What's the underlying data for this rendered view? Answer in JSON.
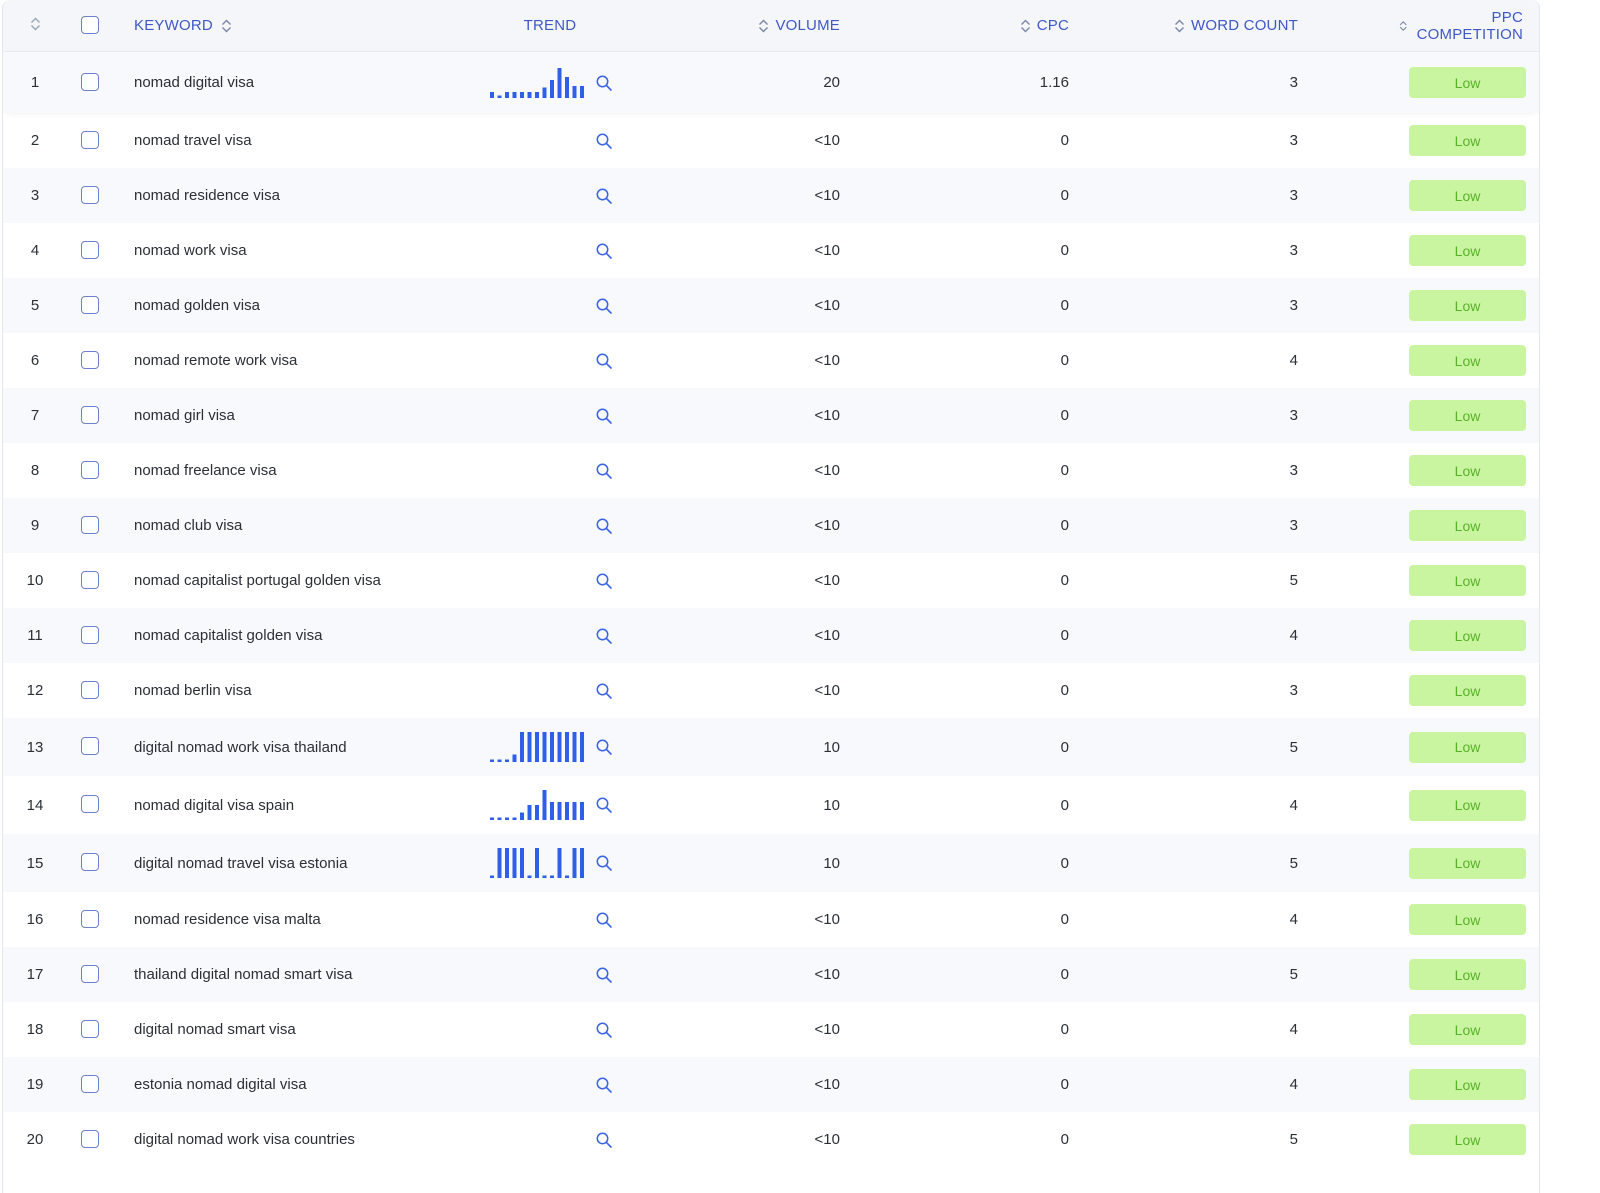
{
  "header": {
    "keyword": "KEYWORD",
    "trend": "TREND",
    "volume": "VOLUME",
    "cpc": "CPC",
    "word_count": "WORD COUNT",
    "ppc_competition": "PPC COMPETITION"
  },
  "colors": {
    "accent": "#2f5fe8",
    "header_text": "#3f58c6",
    "badge_bg": "#c9f5a0",
    "badge_text": "#58b229"
  },
  "rows": [
    {
      "idx": "1",
      "keyword": "nomad digital visa",
      "volume": "20",
      "cpc": "1.16",
      "word_count": "3",
      "ppc": "Low",
      "trend": [
        0.2,
        0.05,
        0.2,
        0.2,
        0.2,
        0.2,
        0.2,
        0.35,
        0.6,
        1.0,
        0.7,
        0.4,
        0.4
      ]
    },
    {
      "idx": "2",
      "keyword": "nomad travel visa",
      "volume": "<10",
      "cpc": "0",
      "word_count": "3",
      "ppc": "Low",
      "trend": []
    },
    {
      "idx": "3",
      "keyword": "nomad residence visa",
      "volume": "<10",
      "cpc": "0",
      "word_count": "3",
      "ppc": "Low",
      "trend": []
    },
    {
      "idx": "4",
      "keyword": "nomad work visa",
      "volume": "<10",
      "cpc": "0",
      "word_count": "3",
      "ppc": "Low",
      "trend": []
    },
    {
      "idx": "5",
      "keyword": "nomad golden visa",
      "volume": "<10",
      "cpc": "0",
      "word_count": "3",
      "ppc": "Low",
      "trend": []
    },
    {
      "idx": "6",
      "keyword": "nomad remote work visa",
      "volume": "<10",
      "cpc": "0",
      "word_count": "4",
      "ppc": "Low",
      "trend": []
    },
    {
      "idx": "7",
      "keyword": "nomad girl visa",
      "volume": "<10",
      "cpc": "0",
      "word_count": "3",
      "ppc": "Low",
      "trend": []
    },
    {
      "idx": "8",
      "keyword": "nomad freelance visa",
      "volume": "<10",
      "cpc": "0",
      "word_count": "3",
      "ppc": "Low",
      "trend": []
    },
    {
      "idx": "9",
      "keyword": "nomad club visa",
      "volume": "<10",
      "cpc": "0",
      "word_count": "3",
      "ppc": "Low",
      "trend": []
    },
    {
      "idx": "10",
      "keyword": "nomad capitalist portugal golden visa",
      "volume": "<10",
      "cpc": "0",
      "word_count": "5",
      "ppc": "Low",
      "trend": []
    },
    {
      "idx": "11",
      "keyword": "nomad capitalist golden visa",
      "volume": "<10",
      "cpc": "0",
      "word_count": "4",
      "ppc": "Low",
      "trend": []
    },
    {
      "idx": "12",
      "keyword": "nomad berlin visa",
      "volume": "<10",
      "cpc": "0",
      "word_count": "3",
      "ppc": "Low",
      "trend": []
    },
    {
      "idx": "13",
      "keyword": "digital nomad work visa thailand",
      "volume": "10",
      "cpc": "0",
      "word_count": "5",
      "ppc": "Low",
      "trend": [
        0.08,
        0.08,
        0.08,
        0.25,
        1.0,
        1.0,
        1.0,
        1.0,
        1.0,
        1.0,
        1.0,
        1.0,
        1.0
      ]
    },
    {
      "idx": "14",
      "keyword": "nomad digital visa spain",
      "volume": "10",
      "cpc": "0",
      "word_count": "4",
      "ppc": "Low",
      "trend": [
        0.08,
        0.08,
        0.08,
        0.08,
        0.25,
        0.5,
        0.5,
        1.0,
        0.6,
        0.6,
        0.6,
        0.6,
        0.6
      ]
    },
    {
      "idx": "15",
      "keyword": "digital nomad travel visa estonia",
      "volume": "10",
      "cpc": "0",
      "word_count": "5",
      "ppc": "Low",
      "trend": [
        0.08,
        1.0,
        1.0,
        1.0,
        1.0,
        0.08,
        1.0,
        0.08,
        0.08,
        1.0,
        0.08,
        1.0,
        1.0
      ]
    },
    {
      "idx": "16",
      "keyword": "nomad residence visa malta",
      "volume": "<10",
      "cpc": "0",
      "word_count": "4",
      "ppc": "Low",
      "trend": []
    },
    {
      "idx": "17",
      "keyword": "thailand digital nomad smart visa",
      "volume": "<10",
      "cpc": "0",
      "word_count": "5",
      "ppc": "Low",
      "trend": []
    },
    {
      "idx": "18",
      "keyword": "digital nomad smart visa",
      "volume": "<10",
      "cpc": "0",
      "word_count": "4",
      "ppc": "Low",
      "trend": []
    },
    {
      "idx": "19",
      "keyword": "estonia nomad digital visa",
      "volume": "<10",
      "cpc": "0",
      "word_count": "4",
      "ppc": "Low",
      "trend": []
    },
    {
      "idx": "20",
      "keyword": "digital nomad work visa countries",
      "volume": "<10",
      "cpc": "0",
      "word_count": "5",
      "ppc": "Low",
      "trend": []
    }
  ]
}
